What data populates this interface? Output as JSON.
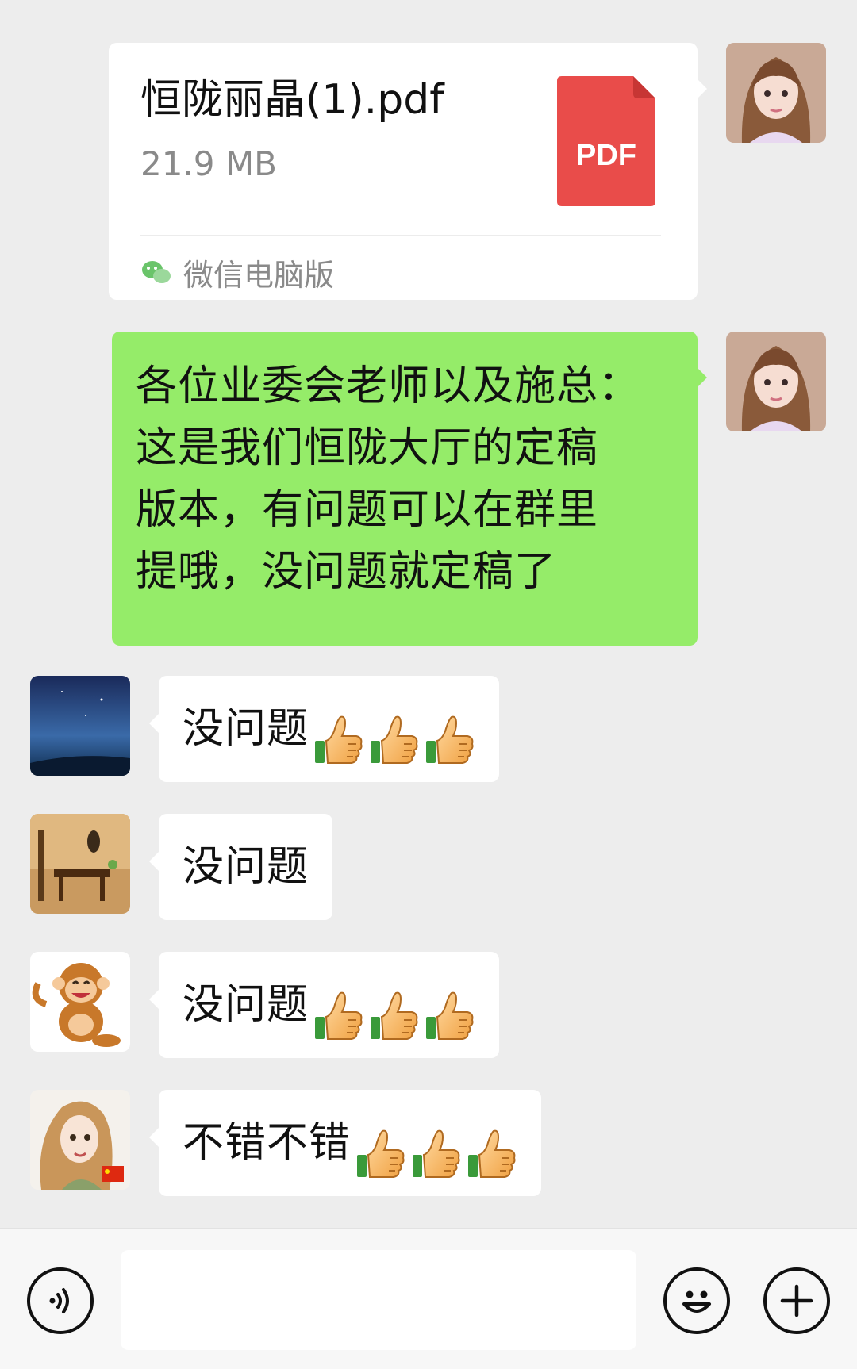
{
  "messages": {
    "file": {
      "name": "恒陇丽晶(1).pdf",
      "size": "21.9 MB",
      "file_type_label": "PDF",
      "source": "微信电脑版",
      "icon": "pdf-file-icon",
      "source_icon": "wechat-icon"
    },
    "announcement": {
      "lines": [
        "各位业委会老师以及施总：",
        "这是我们恒陇大厅的定稿",
        "版本，有问题可以在群里",
        "提哦，没问题就定稿了"
      ]
    },
    "replies": [
      {
        "text": "没问题",
        "emoji": "thumbs-up",
        "emoji_count": 3,
        "avatar": "night-sky-avatar"
      },
      {
        "text": "没问题",
        "emoji": "",
        "emoji_count": 0,
        "avatar": "interior-avatar"
      },
      {
        "text": "没问题",
        "emoji": "thumbs-up",
        "emoji_count": 3,
        "avatar": "monkey-avatar"
      },
      {
        "text": "不错不错",
        "emoji": "thumbs-up",
        "emoji_count": 3,
        "avatar": "curly-girl-avatar"
      }
    ]
  },
  "input_bar": {
    "voice_icon": "voice-icon",
    "emoji_icon": "emoji-icon",
    "more_icon": "plus-icon",
    "input_value": ""
  },
  "colors": {
    "background": "#ededed",
    "self_bubble": "#95ec69",
    "other_bubble": "#ffffff",
    "pdf_red": "#e94c4a"
  }
}
